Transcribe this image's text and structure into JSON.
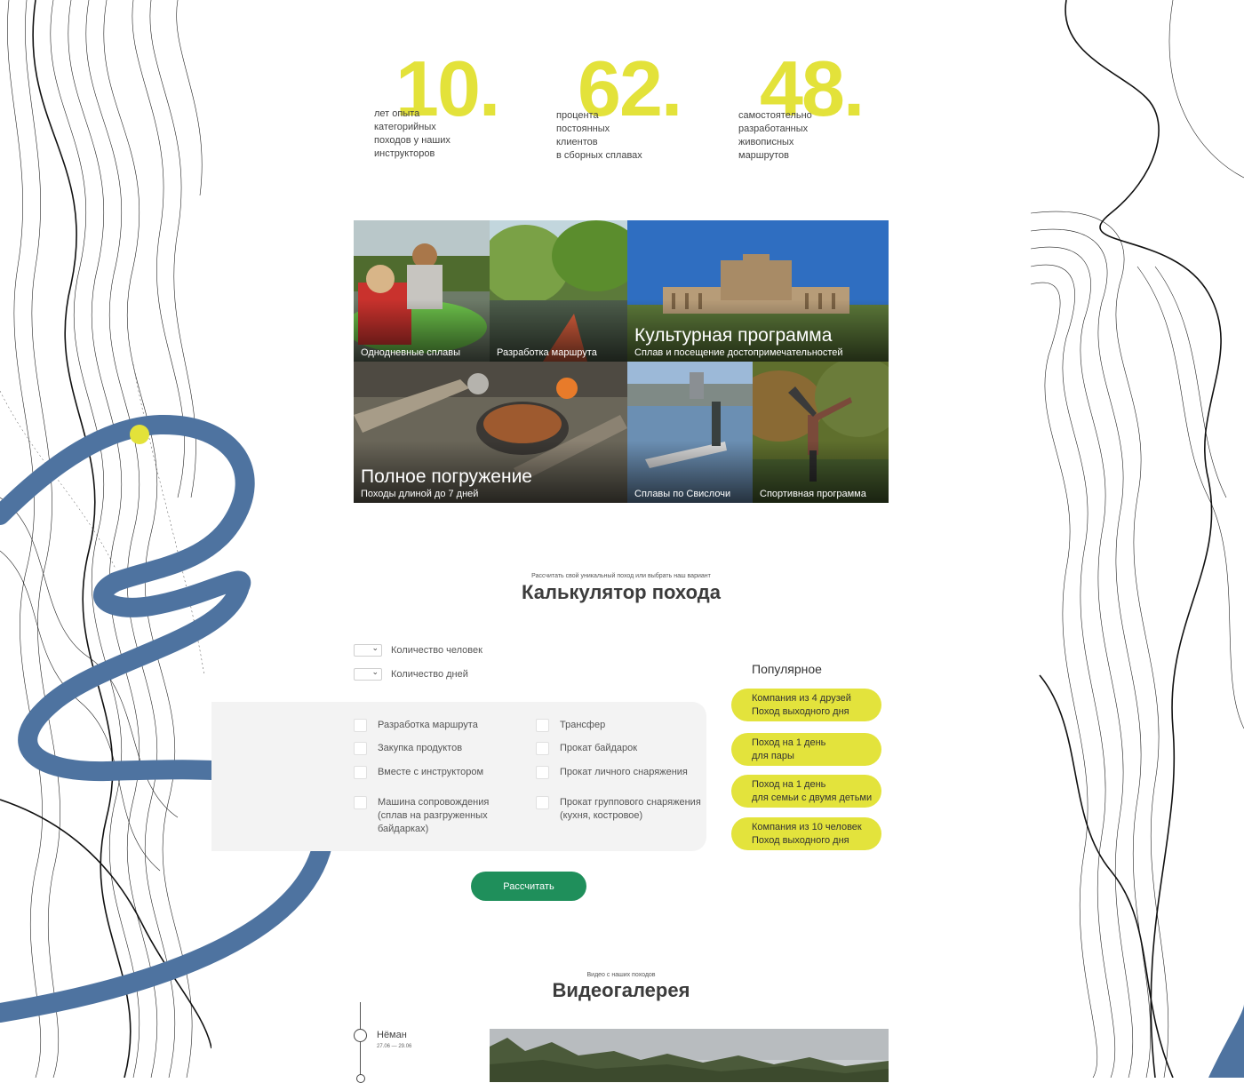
{
  "stats": [
    {
      "value": "10.",
      "desc_lines": [
        "лет опыта",
        "категорийных",
        "походов у наших",
        "инструкторов"
      ]
    },
    {
      "value": "62.",
      "desc_lines": [
        "процента",
        "постоянных",
        "клиентов",
        "в сборных сплавах"
      ]
    },
    {
      "value": "48.",
      "desc_lines": [
        "самостоятельно",
        "разработанных",
        "живописных",
        "маршрутов"
      ]
    }
  ],
  "tiles": {
    "one_day": {
      "label": "Однодневные сплавы"
    },
    "route": {
      "label": "Разработка маршрута"
    },
    "culture": {
      "title": "Культурная программа",
      "label": "Сплав и посещение достопримечательностей"
    },
    "immersion": {
      "title": "Полное погружение",
      "label": "Походы длиной до 7 дней"
    },
    "svisloch": {
      "label": "Сплавы по Свислочи"
    },
    "sport": {
      "label": "Спортивная программа"
    }
  },
  "calculator": {
    "subtitle": "Рассчитать свой уникальный поход или выбрать наш вариант",
    "title": "Калькулятор похода",
    "people_label": "Количество человек",
    "days_label": "Количество дней",
    "options_left": [
      "Разработка  маршрута",
      "Закупка продуктов",
      "Вместе с инструктором",
      "Машина сопровождения (сплав на разгруженных байдарках)"
    ],
    "options_right": [
      "Трансфер",
      "Прокат байдарок",
      "Прокат личного снаряжения",
      "Прокат группового снаряжения (кухня, костровое)"
    ],
    "button": "Рассчитать"
  },
  "popular": {
    "title": "Популярное",
    "items": [
      {
        "line1": "Компания из 4 друзей",
        "line2": "Поход выходного дня"
      },
      {
        "line1": "Поход на 1 день",
        "line2": "для пары"
      },
      {
        "line1": "Поход на 1 день",
        "line2": "для семьи с двумя детьми"
      },
      {
        "line1": "Компания из 10 человек",
        "line2": "Поход выходного дня"
      }
    ]
  },
  "video": {
    "subtitle": "Видео с наших походов",
    "title": "Видеогалерея",
    "timeline_item": {
      "name": "Нёман",
      "date": "27.06 — 29.06"
    }
  },
  "colors": {
    "accent_yellow": "#e3e23a",
    "river_blue": "#4e73a0",
    "button_green": "#1f8f5b",
    "panel_gray": "#f3f3f3"
  }
}
